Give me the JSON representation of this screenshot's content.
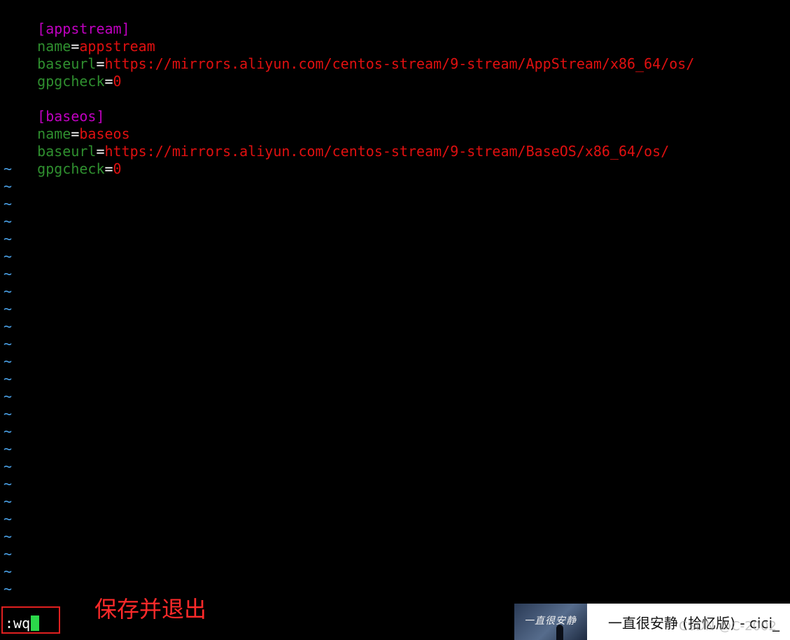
{
  "editor": {
    "lines": [
      {
        "type": "section",
        "text": "[appstream]"
      },
      {
        "type": "kv",
        "key": "name",
        "value": "appstream"
      },
      {
        "type": "kv",
        "key": "baseurl",
        "value": "https://mirrors.aliyun.com/centos-stream/9-stream/AppStream/x86_64/os/"
      },
      {
        "type": "kv",
        "key": "gpgcheck",
        "value": "0"
      },
      {
        "type": "blank",
        "text": ""
      },
      {
        "type": "section",
        "text": "[baseos]"
      },
      {
        "type": "kv",
        "key": "name",
        "value": "baseos"
      },
      {
        "type": "kv",
        "key": "baseurl",
        "value": "https://mirrors.aliyun.com/centos-stream/9-stream/BaseOS/x86_64/os/"
      },
      {
        "type": "kv",
        "key": "gpgcheck",
        "value": "0"
      }
    ],
    "equals": "=",
    "tilde": "~",
    "tilde_count": 25
  },
  "command_line": {
    "text": ":wq"
  },
  "annotation": {
    "text": "保存并退出"
  },
  "player": {
    "album_art_text": "一直很安静",
    "song_title": "一直很安静 (拾忆版) - cici_"
  },
  "watermark": {
    "text": "CSDN @C-2002"
  },
  "colors": {
    "section": "#c000c0",
    "key": "#2f8f2f",
    "value": "#e01010",
    "tilde": "#4aa0e6",
    "cursor": "#2bd84a",
    "highlight": "#e02020"
  }
}
